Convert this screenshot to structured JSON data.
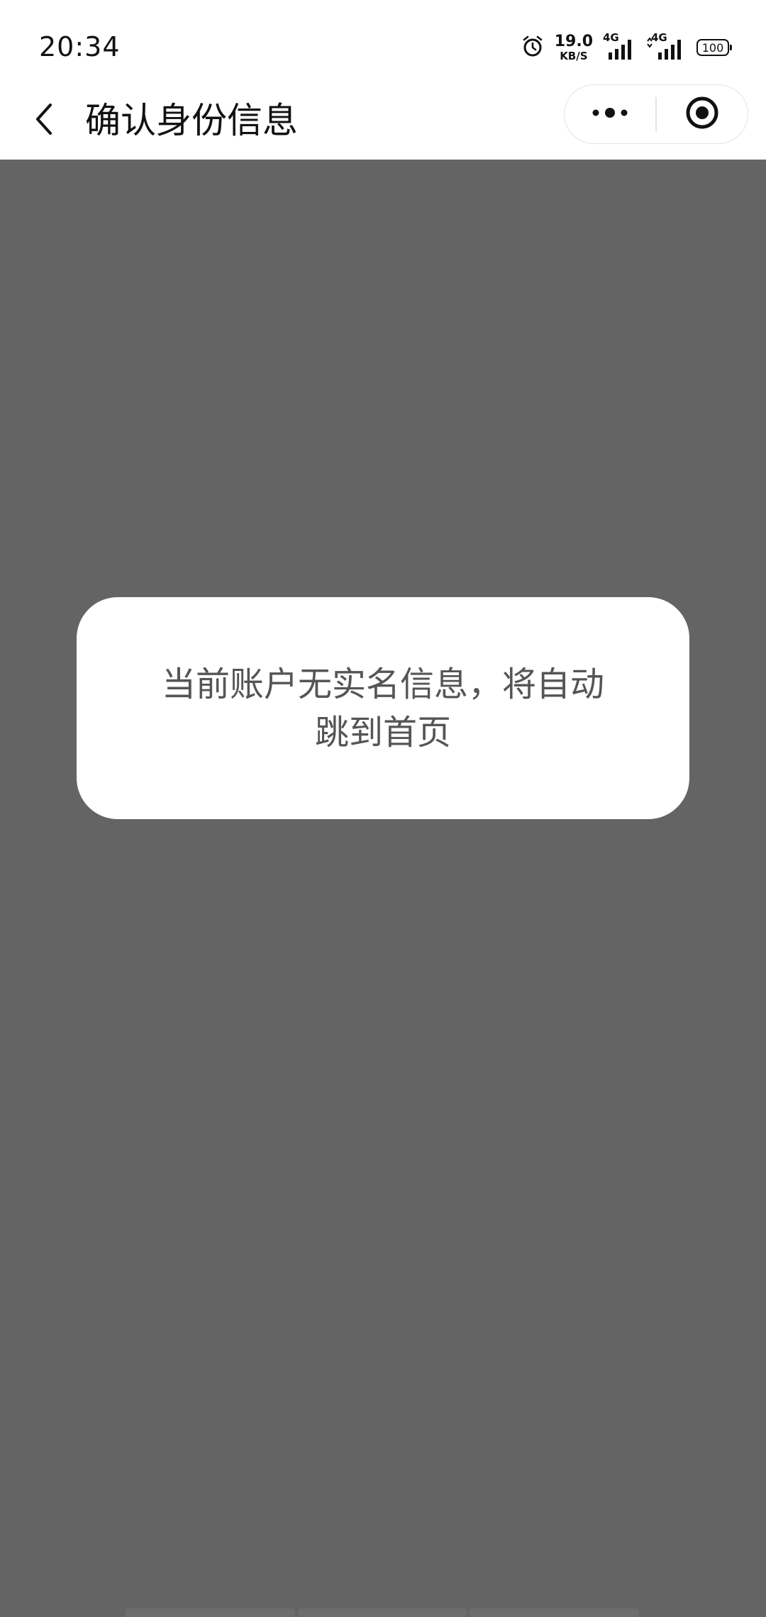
{
  "status_bar": {
    "time": "20:34",
    "net_speed_value": "19.0",
    "net_speed_unit": "KB/S",
    "signal_1_label": "4G",
    "signal_2_label": "4G",
    "battery": "100"
  },
  "nav": {
    "title": "确认身份信息"
  },
  "toast": {
    "message": "当前账户无实名信息，将自动跳到首页"
  },
  "colors": {
    "mask": "#646464",
    "toast_bg": "#ffffff",
    "toast_text": "#555555"
  }
}
